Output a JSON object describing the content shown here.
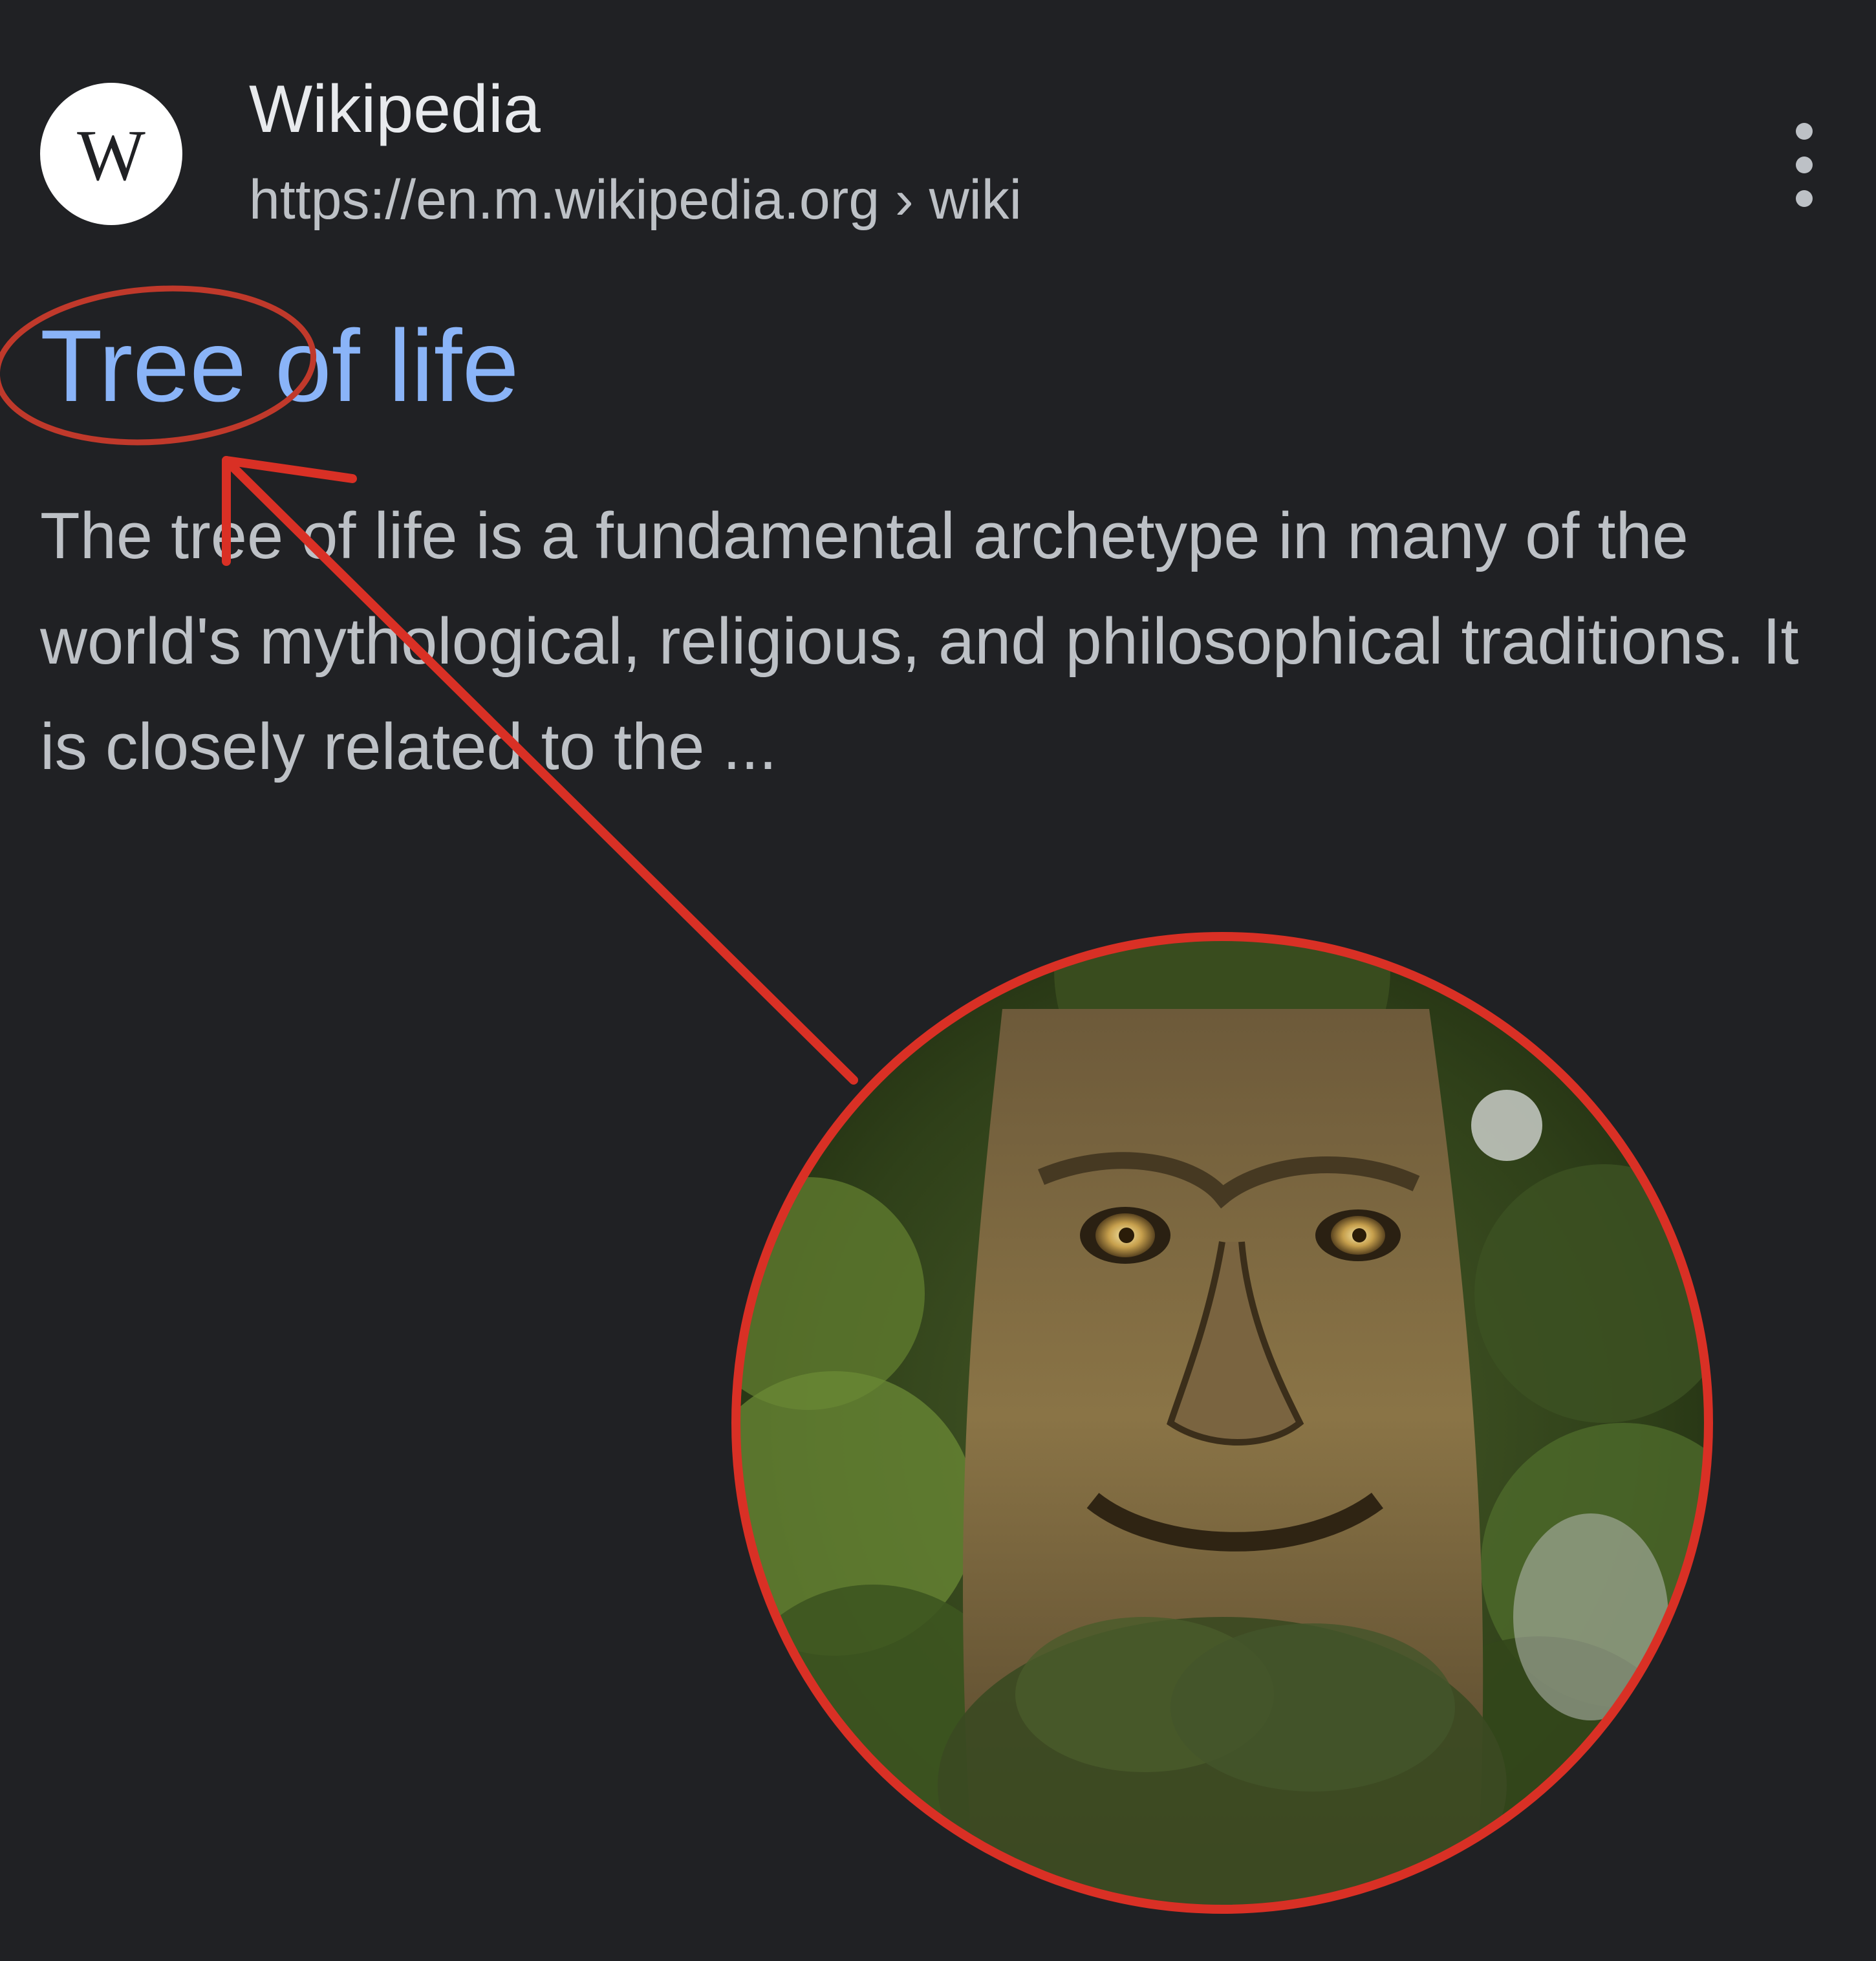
{
  "result": {
    "favicon_letter": "W",
    "site_name": "Wikipedia",
    "url": "https://en.m.wikipedia.org › wiki",
    "title": "Tree of life",
    "snippet": "The tree of life is a fundamental archetype in many of the world's mythological, religious, and philosophical traditions. It is closely related to the ..."
  },
  "icons": {
    "menu": "three-dot-vertical-icon"
  },
  "colors": {
    "background": "#202124",
    "title_link": "#8ab4f8",
    "site_name": "#e8eaed",
    "text": "#bdc1c6",
    "annotation": "#d93025"
  },
  "overlay_image": {
    "description_tag": "tree-face-meme"
  }
}
